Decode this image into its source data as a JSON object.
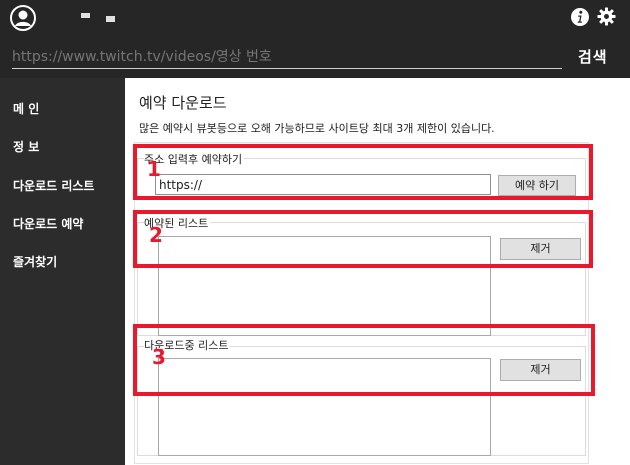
{
  "header": {
    "url_placeholder": "https://www.twitch.tv/videos/영상 번호",
    "search_label": "검색",
    "minimize_label": "-",
    "maximize_label": "-"
  },
  "sidebar": {
    "items": [
      {
        "label": "메 인"
      },
      {
        "label": "정 보"
      },
      {
        "label": "다운로드 리스트"
      },
      {
        "label": "다운로드 예약"
      },
      {
        "label": "즐겨찾기"
      }
    ]
  },
  "main": {
    "title": "예약 다운로드",
    "notice": "많은 예약시 뷰봇등으로 오해 가능하므로 사이트당 최대 3개 제한이 있습니다.",
    "address_group": {
      "label": "주소 입력후 예약하기",
      "input_value": "https://",
      "button_label": "예약 하기"
    },
    "reserved_group": {
      "label": "예약된 리스트",
      "button_label": "제거"
    },
    "downloading_group": {
      "label": "다운로드중 리스트",
      "button_label": "제거"
    }
  },
  "annotations": [
    "1",
    "2",
    "3"
  ],
  "colors": {
    "titlebar": "#262626",
    "sidebar": "#2c2c2c",
    "annotation": "#e8192c"
  }
}
